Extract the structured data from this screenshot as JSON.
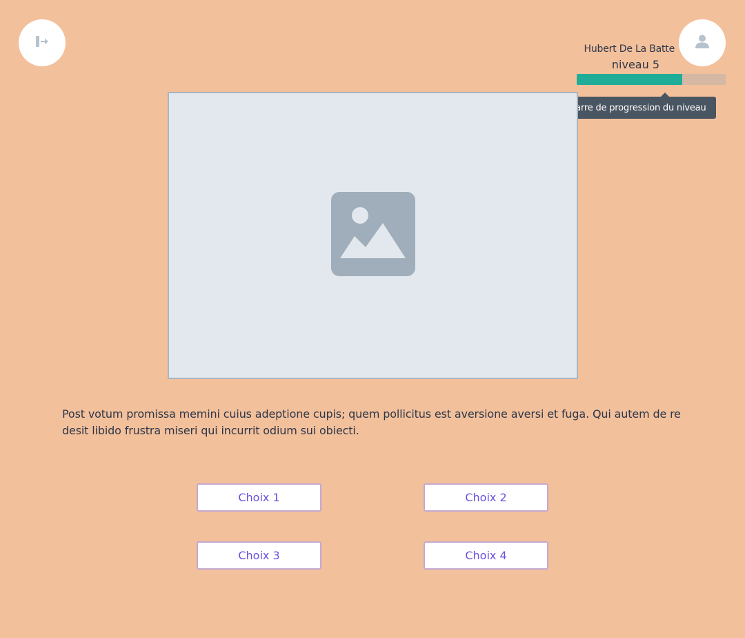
{
  "header": {
    "logout_icon": "logout-icon",
    "avatar_icon": "user-icon",
    "user_name": "Hubert De La Batte",
    "level_label": "niveau 5",
    "progress": {
      "fraction": 0.71,
      "fill_color": "#1fad98",
      "track_color": "#d4b8a4"
    },
    "tooltip": "Barre de progression du niveau"
  },
  "main": {
    "image_icon": "image-placeholder-icon",
    "question": "Post votum promissa memini cuius adeptione cupis; quem pollicitus est aversione aversi et fuga. Qui autem de re desit libido frustra miseri qui incurrit odium sui obiecti.",
    "choices": [
      {
        "label": "Choix 1"
      },
      {
        "label": "Choix 2"
      },
      {
        "label": "Choix 3"
      },
      {
        "label": "Choix 4"
      }
    ]
  },
  "colors": {
    "background": "#f3c09c",
    "accent": "#6b4fe0",
    "text": "#2d3748"
  }
}
